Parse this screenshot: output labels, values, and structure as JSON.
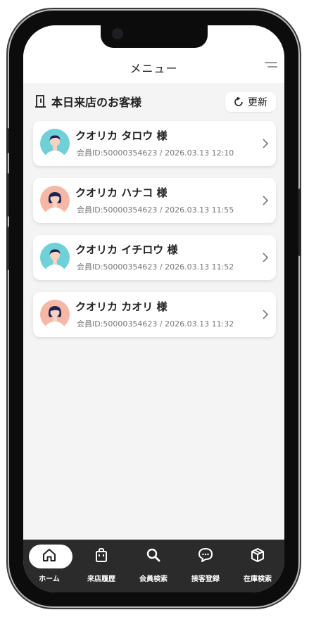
{
  "header": {
    "title": "メニュー"
  },
  "section": {
    "title": "本日来店のお客様",
    "update_label": "更新"
  },
  "customers": [
    {
      "name": "クオリカ タロウ 様",
      "meta": "会員ID:50000354623 / 2026.03.13  12:10",
      "avatar": "male"
    },
    {
      "name": "クオリカ ハナコ 様",
      "meta": "会員ID:50000354623 / 2026.03.13  11:55",
      "avatar": "female"
    },
    {
      "name": "クオリカ イチロウ 様",
      "meta": "会員ID:50000354623 / 2026.03.13  11:52",
      "avatar": "male"
    },
    {
      "name": "クオリカ カオリ 様",
      "meta": "会員ID:50000354623 / 2026.03.13  11:32",
      "avatar": "female"
    }
  ],
  "tabs": [
    {
      "label": "ホーム",
      "icon": "home-icon",
      "active": true
    },
    {
      "label": "来店履歴",
      "icon": "shopping-bag-icon",
      "active": false
    },
    {
      "label": "会員検索",
      "icon": "search-icon",
      "active": false
    },
    {
      "label": "接客登録",
      "icon": "chat-bubble-icon",
      "active": false
    },
    {
      "label": "在庫検索",
      "icon": "box-icon",
      "active": false
    }
  ],
  "colors": {
    "male_avatar_bg": "#6fd0d8",
    "female_avatar_bg": "#f6b8a6",
    "tabbar_bg": "#2b2b2b"
  }
}
